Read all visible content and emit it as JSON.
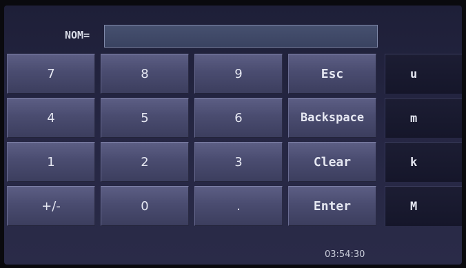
{
  "input": {
    "label": "NOM=",
    "value": ""
  },
  "keypad": {
    "row1": [
      "7",
      "8",
      "9",
      "Esc"
    ],
    "row2": [
      "4",
      "5",
      "6",
      "Backspace"
    ],
    "row3": [
      "1",
      "2",
      "3",
      "Clear"
    ],
    "row4": [
      "+/-",
      "0",
      ".",
      "Enter"
    ]
  },
  "units": [
    "u",
    "m",
    "k",
    "M"
  ],
  "status": {
    "time": "03:54:30"
  },
  "colors": {
    "background": "#24253f",
    "key": "#4c4e72",
    "unit_key": "#18192e",
    "text": "#e6e8f2"
  }
}
